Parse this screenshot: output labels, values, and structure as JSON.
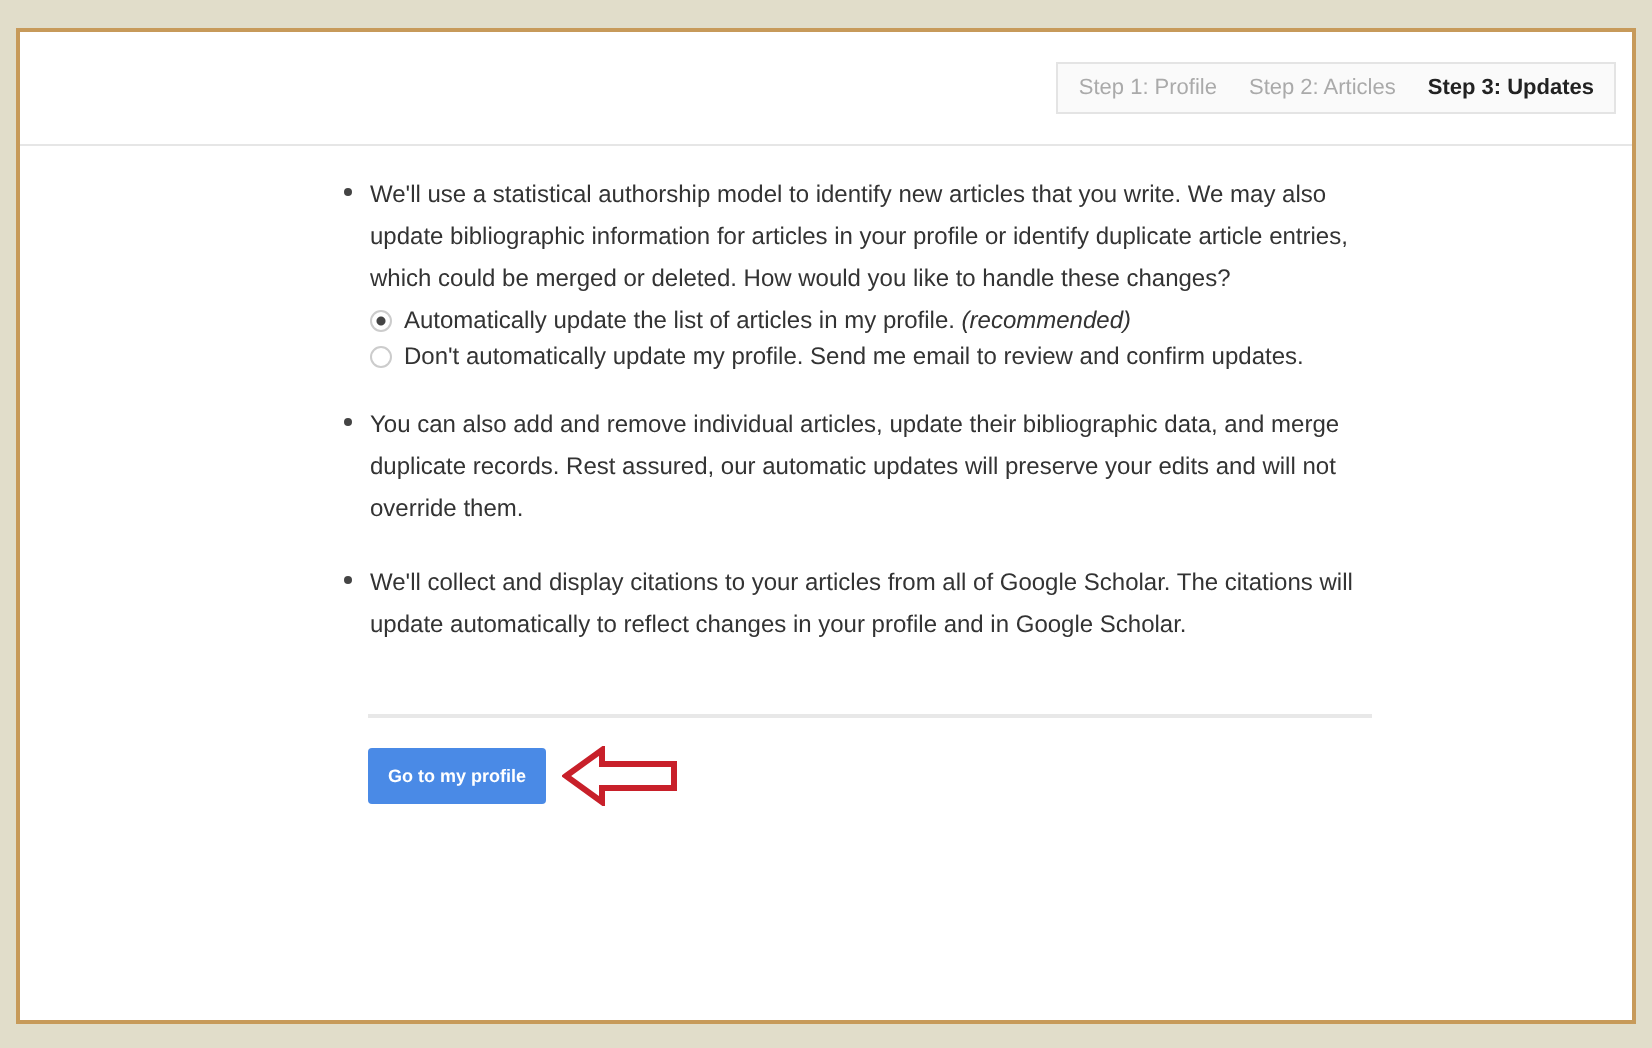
{
  "steps": [
    {
      "label": "Step 1: Profile",
      "selected": false
    },
    {
      "label": "Step 2: Articles",
      "selected": false
    },
    {
      "label": "Step 3: Updates",
      "selected": true
    }
  ],
  "items": [
    {
      "text": "We'll use a statistical authorship model to identify new articles that you write. We may also update bibliographic information for articles in your profile or identify duplicate article entries, which could be merged or deleted. How would you like to handle these changes?",
      "options": [
        {
          "label": "Automatically update the list of articles in my profile. *(recommended)*",
          "selected": true
        },
        {
          "label": "Don't automatically update my profile. Send me email to review and confirm updates.",
          "selected": false
        }
      ]
    },
    {
      "text": "You can also add and remove individual articles, update their bibliographic data, and merge duplicate records. Rest assured, our automatic updates will preserve your edits and will not override them."
    },
    {
      "text": "We'll collect and display citations to your articles from all of Google Scholar. The citations will update automatically to reflect changes in your profile and in Google Scholar."
    }
  ],
  "button": {
    "label": "Go to my profile"
  }
}
